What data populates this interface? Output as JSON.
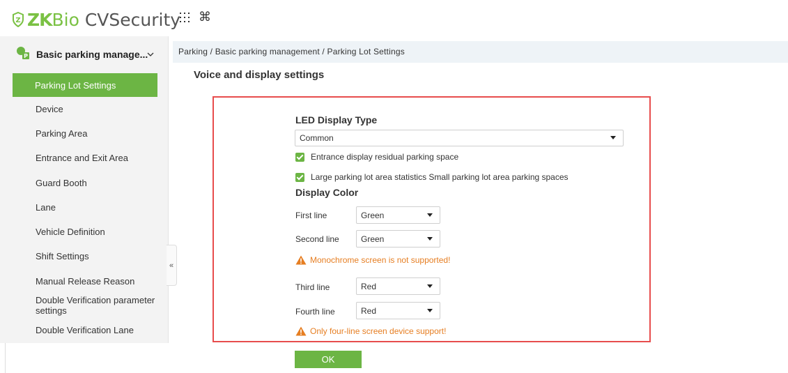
{
  "header": {
    "logo_mark": "Ⓩ",
    "logo_zk": "ZK",
    "logo_bio": "Bio",
    "logo_rest": " CVSecurity",
    "apps_icon": "apps-grid-icon",
    "command_icon": "command-icon"
  },
  "sidebar": {
    "module_title": "Basic parking manage...",
    "items": [
      {
        "label": "Parking Lot Settings",
        "active": true
      },
      {
        "label": "Device"
      },
      {
        "label": "Parking Area"
      },
      {
        "label": "Entrance and Exit Area"
      },
      {
        "label": "Guard Booth"
      },
      {
        "label": "Lane"
      },
      {
        "label": "Vehicle Definition"
      },
      {
        "label": "Shift Settings"
      },
      {
        "label": "Manual Release Reason"
      },
      {
        "label": "Double Verification parameter settings"
      },
      {
        "label": "Double Verification Lane"
      }
    ],
    "collapse_glyph": "«"
  },
  "breadcrumb": "Parking / Basic parking management / Parking Lot Settings",
  "page_title": "Voice and display settings",
  "form": {
    "led_type_label": "LED Display Type",
    "led_type_value": "Common",
    "check_entrance": "Entrance display residual parking space",
    "check_large": "Large parking lot area statistics Small parking lot area parking spaces",
    "display_color_label": "Display Color",
    "first_line_label": "First line",
    "first_line_value": "Green",
    "second_line_label": "Second line",
    "second_line_value": "Green",
    "warn_mono": "Monochrome screen is not supported!",
    "third_line_label": "Third line",
    "third_line_value": "Red",
    "fourth_line_label": "Fourth line",
    "fourth_line_value": "Red",
    "warn_four": "Only four-line screen device support!",
    "ok_label": "OK"
  },
  "colors": {
    "accent_green": "#6cb544",
    "highlight_red": "#e74c4c",
    "warning_orange": "#e67e22"
  }
}
